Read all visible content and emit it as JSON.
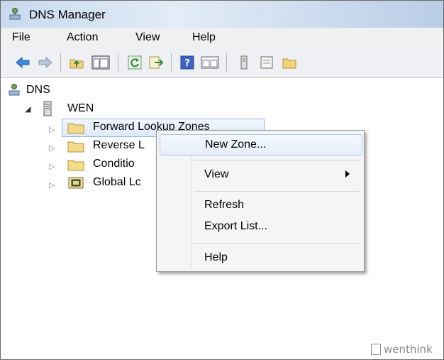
{
  "window": {
    "title": "DNS Manager"
  },
  "menubar": {
    "items": [
      "File",
      "Action",
      "View",
      "Help"
    ]
  },
  "toolbar": {
    "icons": [
      "back-arrow-icon",
      "forward-arrow-icon",
      "up-folder-icon",
      "show-hide-console-tree-icon",
      "refresh-icon",
      "export-list-icon",
      "help-icon",
      "properties-icon",
      "server-icon",
      "list-icon",
      "folder-icon"
    ]
  },
  "tree": {
    "root": "DNS",
    "server": "WEN",
    "children": [
      {
        "label": "Forward Lookup Zones"
      },
      {
        "label": "Reverse L"
      },
      {
        "label": "Conditio"
      },
      {
        "label": "Global Lc"
      }
    ]
  },
  "context_menu": {
    "items": [
      "New Zone...",
      "View",
      "Refresh",
      "Export List...",
      "Help"
    ]
  },
  "watermark": "wenthink",
  "colors": {
    "selection": "#dfeaf8",
    "menu_background": "#f5f5f5",
    "titlebar": "#c8d9ee"
  }
}
